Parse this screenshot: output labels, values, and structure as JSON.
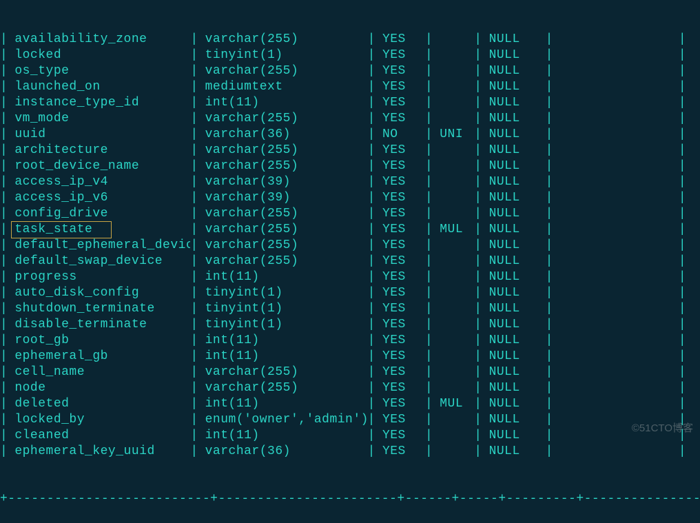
{
  "rows": [
    {
      "field": "availability_zone",
      "type": "varchar(255)",
      "null": "YES",
      "key": "",
      "default": "NULL",
      "extra": "",
      "highlighted": false
    },
    {
      "field": "locked",
      "type": "tinyint(1)",
      "null": "YES",
      "key": "",
      "default": "NULL",
      "extra": "",
      "highlighted": false
    },
    {
      "field": "os_type",
      "type": "varchar(255)",
      "null": "YES",
      "key": "",
      "default": "NULL",
      "extra": "",
      "highlighted": false
    },
    {
      "field": "launched_on",
      "type": "mediumtext",
      "null": "YES",
      "key": "",
      "default": "NULL",
      "extra": "",
      "highlighted": false
    },
    {
      "field": "instance_type_id",
      "type": "int(11)",
      "null": "YES",
      "key": "",
      "default": "NULL",
      "extra": "",
      "highlighted": false
    },
    {
      "field": "vm_mode",
      "type": "varchar(255)",
      "null": "YES",
      "key": "",
      "default": "NULL",
      "extra": "",
      "highlighted": false
    },
    {
      "field": "uuid",
      "type": "varchar(36)",
      "null": "NO",
      "key": "UNI",
      "default": "NULL",
      "extra": "",
      "highlighted": false
    },
    {
      "field": "architecture",
      "type": "varchar(255)",
      "null": "YES",
      "key": "",
      "default": "NULL",
      "extra": "",
      "highlighted": false
    },
    {
      "field": "root_device_name",
      "type": "varchar(255)",
      "null": "YES",
      "key": "",
      "default": "NULL",
      "extra": "",
      "highlighted": false
    },
    {
      "field": "access_ip_v4",
      "type": "varchar(39)",
      "null": "YES",
      "key": "",
      "default": "NULL",
      "extra": "",
      "highlighted": false
    },
    {
      "field": "access_ip_v6",
      "type": "varchar(39)",
      "null": "YES",
      "key": "",
      "default": "NULL",
      "extra": "",
      "highlighted": false
    },
    {
      "field": "config_drive",
      "type": "varchar(255)",
      "null": "YES",
      "key": "",
      "default": "NULL",
      "extra": "",
      "highlighted": false
    },
    {
      "field": "task_state",
      "type": "varchar(255)",
      "null": "YES",
      "key": "MUL",
      "default": "NULL",
      "extra": "",
      "highlighted": true
    },
    {
      "field": "default_ephemeral_device",
      "type": "varchar(255)",
      "null": "YES",
      "key": "",
      "default": "NULL",
      "extra": "",
      "highlighted": false
    },
    {
      "field": "default_swap_device",
      "type": "varchar(255)",
      "null": "YES",
      "key": "",
      "default": "NULL",
      "extra": "",
      "highlighted": false
    },
    {
      "field": "progress",
      "type": "int(11)",
      "null": "YES",
      "key": "",
      "default": "NULL",
      "extra": "",
      "highlighted": false
    },
    {
      "field": "auto_disk_config",
      "type": "tinyint(1)",
      "null": "YES",
      "key": "",
      "default": "NULL",
      "extra": "",
      "highlighted": false
    },
    {
      "field": "shutdown_terminate",
      "type": "tinyint(1)",
      "null": "YES",
      "key": "",
      "default": "NULL",
      "extra": "",
      "highlighted": false
    },
    {
      "field": "disable_terminate",
      "type": "tinyint(1)",
      "null": "YES",
      "key": "",
      "default": "NULL",
      "extra": "",
      "highlighted": false
    },
    {
      "field": "root_gb",
      "type": "int(11)",
      "null": "YES",
      "key": "",
      "default": "NULL",
      "extra": "",
      "highlighted": false
    },
    {
      "field": "ephemeral_gb",
      "type": "int(11)",
      "null": "YES",
      "key": "",
      "default": "NULL",
      "extra": "",
      "highlighted": false
    },
    {
      "field": "cell_name",
      "type": "varchar(255)",
      "null": "YES",
      "key": "",
      "default": "NULL",
      "extra": "",
      "highlighted": false
    },
    {
      "field": "node",
      "type": "varchar(255)",
      "null": "YES",
      "key": "",
      "default": "NULL",
      "extra": "",
      "highlighted": false
    },
    {
      "field": "deleted",
      "type": "int(11)",
      "null": "YES",
      "key": "MUL",
      "default": "NULL",
      "extra": "",
      "highlighted": false
    },
    {
      "field": "locked_by",
      "type": "enum('owner','admin')",
      "null": "YES",
      "key": "",
      "default": "NULL",
      "extra": "",
      "highlighted": false
    },
    {
      "field": "cleaned",
      "type": "int(11)",
      "null": "YES",
      "key": "",
      "default": "NULL",
      "extra": "",
      "highlighted": false
    },
    {
      "field": "ephemeral_key_uuid",
      "type": "varchar(36)",
      "null": "YES",
      "key": "",
      "default": "NULL",
      "extra": "",
      "highlighted": false
    }
  ],
  "separator": "+--------------------------+-----------------------+------+-----+---------+----------------+",
  "watermark": "©51CTO博客"
}
